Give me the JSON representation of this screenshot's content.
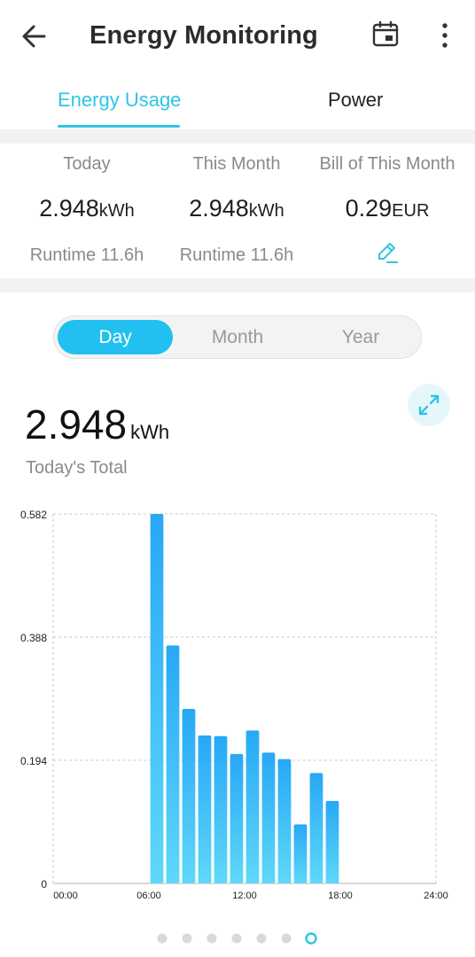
{
  "header": {
    "title": "Energy Monitoring",
    "back_icon": "arrow-left-icon",
    "calendar_icon": "calendar-icon",
    "more_icon": "more-vertical-icon"
  },
  "tabs": [
    {
      "label": "Energy Usage",
      "active": true
    },
    {
      "label": "Power",
      "active": false
    }
  ],
  "summary": {
    "today": {
      "label": "Today",
      "value": "2.948",
      "unit": "kWh",
      "sub": "Runtime 11.6h"
    },
    "month": {
      "label": "This Month",
      "value": "2.948",
      "unit": "kWh",
      "sub": "Runtime 11.6h"
    },
    "bill": {
      "label": "Bill of This Month",
      "value": "0.29",
      "unit": "EUR",
      "edit_icon": "pencil-icon"
    }
  },
  "segments": [
    {
      "label": "Day",
      "active": true
    },
    {
      "label": "Month",
      "active": false
    },
    {
      "label": "Year",
      "active": false
    }
  ],
  "total": {
    "value": "2.948",
    "unit": "kWh",
    "label": "Today's Total",
    "expand_icon": "expand-icon"
  },
  "colors": {
    "accent": "#2ec5e6",
    "bar_top": "#28a8f5",
    "bar_bottom": "#5ed8fa"
  },
  "chart_data": {
    "type": "bar",
    "x": [
      6,
      7,
      8,
      9,
      10,
      11,
      12,
      13,
      14,
      15,
      16,
      17
    ],
    "values": [
      0.582,
      0.375,
      0.275,
      0.233,
      0.232,
      0.204,
      0.241,
      0.206,
      0.196,
      0.093,
      0.174,
      0.13
    ],
    "xlabel": "",
    "ylabel": "",
    "xlim": [
      0,
      24
    ],
    "ylim": [
      0,
      0.582
    ],
    "x_ticks": [
      "00:00",
      "06:00",
      "12:00",
      "18:00",
      "24:00"
    ],
    "y_ticks": [
      "0",
      "0.194",
      "0.388",
      "0.582"
    ],
    "grid": true
  },
  "pager": {
    "count": 7,
    "active": 6
  }
}
